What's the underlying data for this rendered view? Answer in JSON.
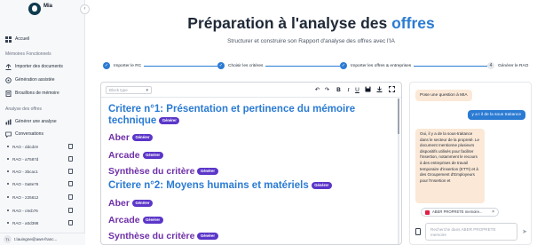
{
  "app": {
    "name": "Mia"
  },
  "sidebar": {
    "nav": [
      {
        "label": "Accueil",
        "icon": "dashboard-icon"
      }
    ],
    "section_memoires": "Mémoires Fonctionnels",
    "memoires_items": [
      {
        "label": "Importer des documents",
        "icon": "upload-icon"
      },
      {
        "label": "Génération assistée",
        "icon": "ai-sparkle-icon"
      },
      {
        "label": "Brouillons de mémoire",
        "icon": "document-icon"
      }
    ],
    "section_offres": "Analyse des offres",
    "offres_items": [
      {
        "label": "Générer une analyse",
        "icon": "chart-icon"
      },
      {
        "label": "Conversations",
        "icon": "chat-icon"
      }
    ],
    "conversations": [
      "RAO - ddcdc9",
      "RAO - a7587d",
      "RAO - 3bcac1",
      "RAO - 0a8e76",
      "RAO - 225612",
      "RAO - c9cb76",
      "RAO - a0d398"
    ],
    "user": {
      "initials": "TL",
      "email": "t.lauingne@aws-franc..."
    }
  },
  "header": {
    "title_main": "Préparation à l'analyse des ",
    "title_accent": "offres",
    "subtitle": "Structurer et construire son Rapport d'analyse des offres avec l'IA"
  },
  "stepper": {
    "steps": [
      {
        "label": "Importer le RC",
        "state": "done",
        "mark": "✓"
      },
      {
        "label": "Choisir les critères",
        "state": "done",
        "mark": "✓"
      },
      {
        "label": "Importer les offres & entreprises",
        "state": "done",
        "mark": "✓"
      },
      {
        "label": "Générer le RAO",
        "state": "current",
        "mark": "4"
      }
    ]
  },
  "editor": {
    "block_type_placeholder": "Block type",
    "generate_label": "Générer",
    "criteria": [
      {
        "title": "Critere n°1: Présentation et pertinence du mémoire technique",
        "subsections": [
          "Aber",
          "Arcade",
          "Synthèse du critère"
        ]
      },
      {
        "title": "Critere n°2: Moyens humains et matériels",
        "subsections": [
          "Aber",
          "Arcade",
          "Synthèse du critère"
        ]
      }
    ]
  },
  "chat": {
    "prompt_hint": "Pose une question à MIA",
    "user_message": "y a t il de la sous traitance",
    "ai_response": "Oui, il y a de la sous-traitance dans le secteur de la propreté. Le document mentionne plusieurs dispositifs utilisés pour faciliter l'insertion, notamment le recours à des entreprises de travail temporaire d'insertion (ETTI) et à des Groupement d'Employeurs pour l'Insertion et",
    "attachment": "ABER PROPRETE memoire...",
    "input_placeholder": "Recherche dans ABER PROPRETE memoire"
  },
  "colors": {
    "accent": "#2b7bd3",
    "purple": "#6f2fa8",
    "generate": "#5b36c9",
    "ai_bubble": "#fbe8d6"
  }
}
